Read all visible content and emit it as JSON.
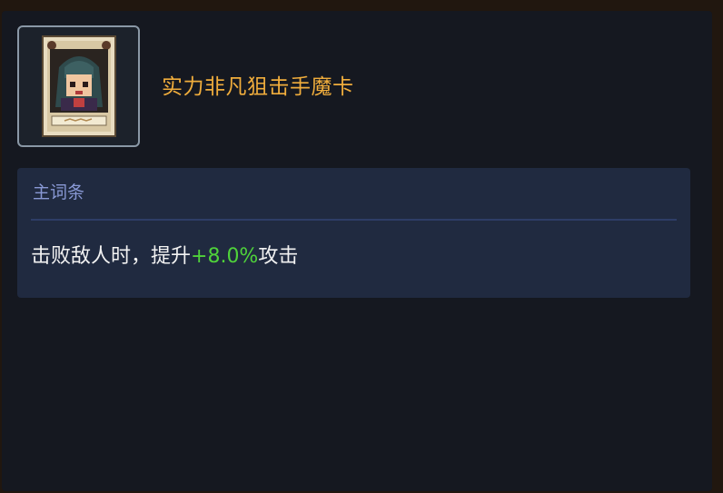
{
  "item": {
    "title": "实力非凡狙击手魔卡",
    "icon": "sniper-card-portrait-icon"
  },
  "affix": {
    "header": "主词条",
    "line_prefix": "击败敌人时，提升",
    "line_value": "+8.0%",
    "line_suffix": "攻击"
  },
  "colors": {
    "title": "#f0ad3c",
    "header": "#8898d4",
    "value_highlight": "#4fd23a",
    "panel_bg": "#151820",
    "affix_bg": "#202a40"
  }
}
